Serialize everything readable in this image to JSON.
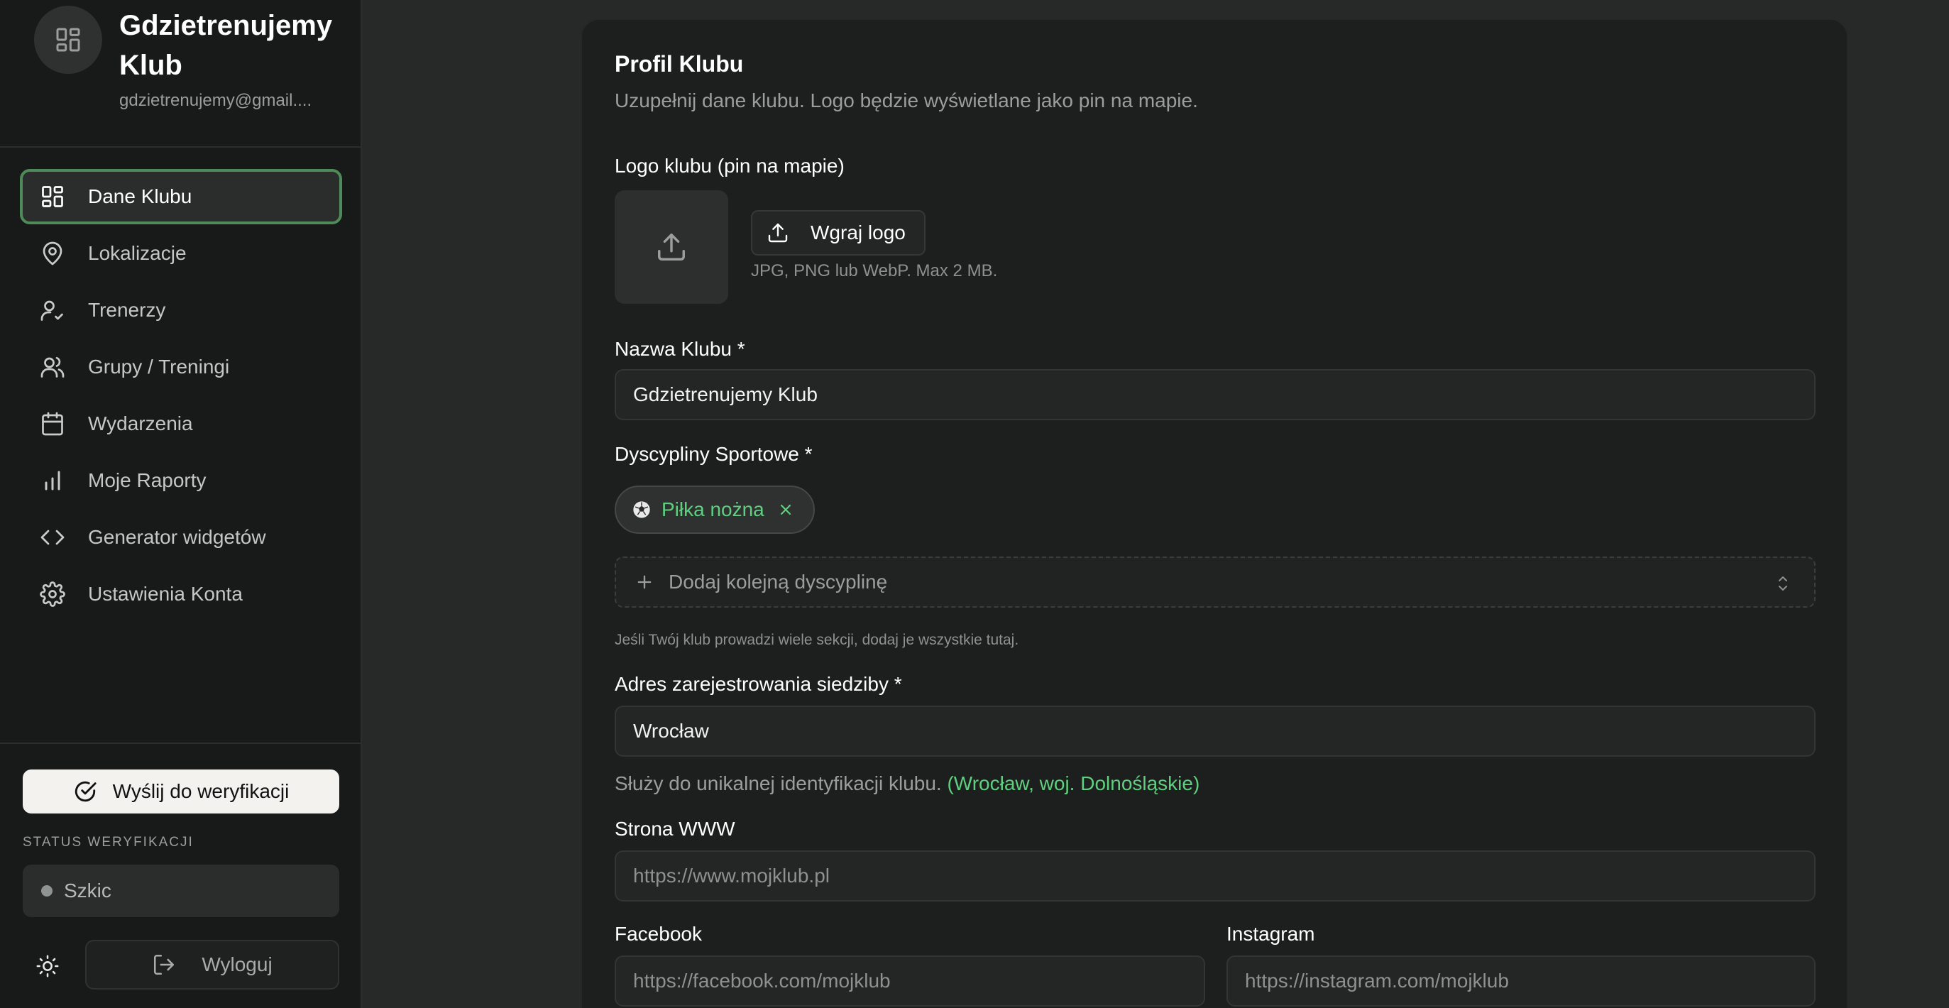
{
  "sidebar": {
    "club_name": "Gdzietrenujemy Klub",
    "club_email": "gdzietrenujemy@gmail....",
    "items": [
      {
        "label": "Dane Klubu",
        "icon": "dashboard-icon"
      },
      {
        "label": "Lokalizacje",
        "icon": "map-pin-icon"
      },
      {
        "label": "Trenerzy",
        "icon": "user-check-icon"
      },
      {
        "label": "Grupy / Treningi",
        "icon": "users-icon"
      },
      {
        "label": "Wydarzenia",
        "icon": "calendar-icon"
      },
      {
        "label": "Moje Raporty",
        "icon": "bar-chart-icon"
      },
      {
        "label": "Generator widgetów",
        "icon": "code-icon"
      },
      {
        "label": "Ustawienia Konta",
        "icon": "gear-icon"
      }
    ],
    "active_item": "Dane Klubu",
    "verify_button": "Wyślij do weryfikacji",
    "status_label": "STATUS WERYFIKACJI",
    "status_value": "Szkic",
    "logout_button": "Wyloguj"
  },
  "form": {
    "title": "Profil Klubu",
    "subtitle": "Uzupełnij dane klubu. Logo będzie wyświetlane jako pin na mapie.",
    "logo_label": "Logo klubu (pin na mapie)",
    "upload_button": "Wgraj logo",
    "logo_hint": "JPG, PNG lub WebP. Max 2 MB.",
    "name_label": "Nazwa Klubu *",
    "name_value": "Gdzietrenujemy Klub",
    "disciplines_label": "Dyscypliny Sportowe *",
    "discipline_chip": "Piłka nożna",
    "add_discipline": "Dodaj kolejną dyscyplinę",
    "disciplines_hint": "Jeśli Twój klub prowadzi wiele sekcji, dodaj je wszystkie tutaj.",
    "address_label": "Adres zarejestrowania siedziby *",
    "address_value": "Wrocław",
    "address_hint": "Służy do unikalnej identyfikacji klubu.",
    "address_resolved": "(Wrocław, woj. Dolnośląskie)",
    "www_label": "Strona WWW",
    "www_placeholder": "https://www.mojklub.pl",
    "facebook_label": "Facebook",
    "facebook_placeholder": "https://facebook.com/mojklub",
    "instagram_label": "Instagram",
    "instagram_placeholder": "https://instagram.com/mojklub"
  },
  "colors": {
    "accent_green": "#5fcf7f",
    "active_border": "#4f8a59",
    "background": "#262928",
    "sidebar": "#181a19",
    "card": "#1d1f1e"
  }
}
